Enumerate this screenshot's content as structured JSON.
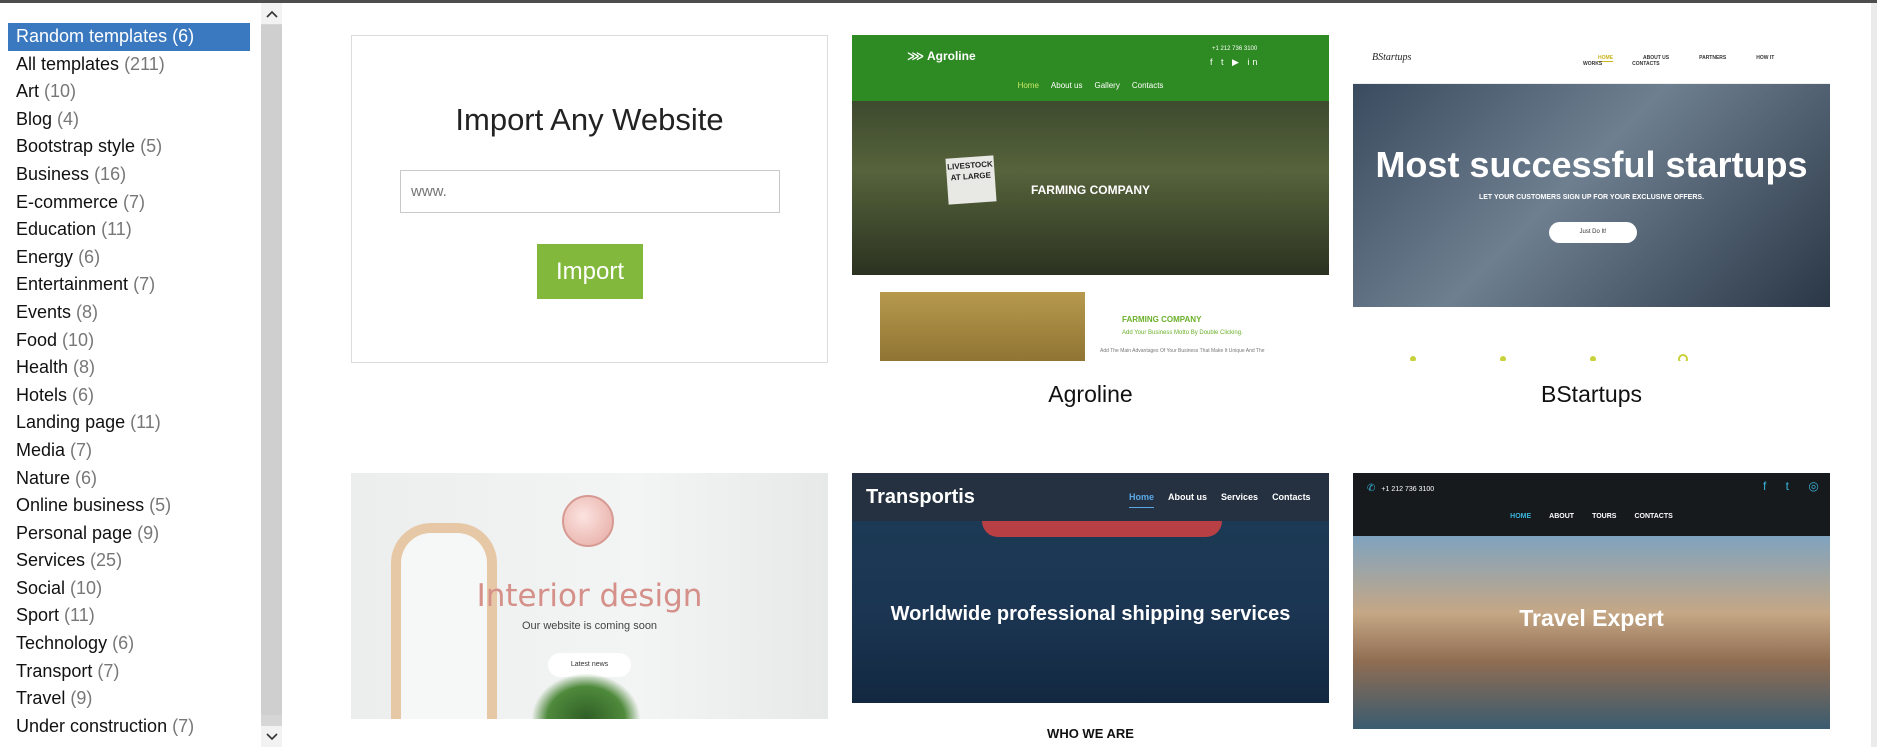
{
  "sidebar": {
    "categories": [
      {
        "label": "Random templates",
        "count": "(6)",
        "selected": true
      },
      {
        "label": "All templates",
        "count": "(211)"
      },
      {
        "label": "Art",
        "count": "(10)"
      },
      {
        "label": "Blog",
        "count": "(4)"
      },
      {
        "label": "Bootstrap style",
        "count": "(5)"
      },
      {
        "label": "Business",
        "count": "(16)"
      },
      {
        "label": "E-commerce",
        "count": "(7)"
      },
      {
        "label": "Education",
        "count": "(11)"
      },
      {
        "label": "Energy",
        "count": "(6)"
      },
      {
        "label": "Entertainment",
        "count": "(7)"
      },
      {
        "label": "Events",
        "count": "(8)"
      },
      {
        "label": "Food",
        "count": "(10)"
      },
      {
        "label": "Health",
        "count": "(8)"
      },
      {
        "label": "Hotels",
        "count": "(6)"
      },
      {
        "label": "Landing page",
        "count": "(11)"
      },
      {
        "label": "Media",
        "count": "(7)"
      },
      {
        "label": "Nature",
        "count": "(6)"
      },
      {
        "label": "Online business",
        "count": "(5)"
      },
      {
        "label": "Personal page",
        "count": "(9)"
      },
      {
        "label": "Services",
        "count": "(25)"
      },
      {
        "label": "Social",
        "count": "(10)"
      },
      {
        "label": "Sport",
        "count": "(11)"
      },
      {
        "label": "Technology",
        "count": "(6)"
      },
      {
        "label": "Transport",
        "count": "(7)"
      },
      {
        "label": "Travel",
        "count": "(9)"
      },
      {
        "label": "Under construction",
        "count": "(7)"
      }
    ],
    "scroll_up_glyph": "︿",
    "scroll_down_glyph": "﹀"
  },
  "import": {
    "title": "Import Any Website",
    "placeholder": "www.",
    "button": "Import"
  },
  "templates": {
    "agroline": {
      "name": "Agroline",
      "logo": "Agroline",
      "phone": "+1 212 736 3100",
      "social": "f t ▶ in",
      "nav": [
        "Home",
        "About us",
        "Gallery",
        "Contacts"
      ],
      "hero": "FARMING COMPANY",
      "sign": "LIVESTOCK AT LARGE",
      "section_title": "FARMING COMPANY",
      "section_sub": "Add Your Business Motto By Double Clicking.",
      "section_body": "Add The Main Advantages Of Your Business That Make It Unique And The"
    },
    "bstartups": {
      "name": "BStartups",
      "logo": "BStartups",
      "nav": [
        "HOME",
        "ABOUT US",
        "PARTNERS",
        "HOW IT WORKS",
        "CONTACTS"
      ],
      "hero": "Most successful startups",
      "sub": "LET YOUR CUSTOMERS SIGN UP FOR YOUR EXCLUSIVE OFFERS.",
      "button": "Just Do It!"
    },
    "interior": {
      "title": "Interior design",
      "sub": "Our website is coming soon",
      "button": "Latest news"
    },
    "transportis": {
      "logo": "Transportis",
      "nav": [
        "Home",
        "About us",
        "Services",
        "Contacts"
      ],
      "hero": "Worldwide professional shipping services",
      "section": "WHO WE ARE"
    },
    "travel": {
      "phone": "+1 212 736 3100",
      "social": "f t ◎",
      "nav": [
        "HOME",
        "ABOUT",
        "TOURS",
        "CONTACTS"
      ],
      "hero": "Travel Expert"
    }
  },
  "colors": {
    "selected": "#3a79c0",
    "import_button": "#82b83c",
    "agroline_green": "#2e8b23",
    "transportis_header": "#253140",
    "travel_accent": "#39b3d9"
  }
}
